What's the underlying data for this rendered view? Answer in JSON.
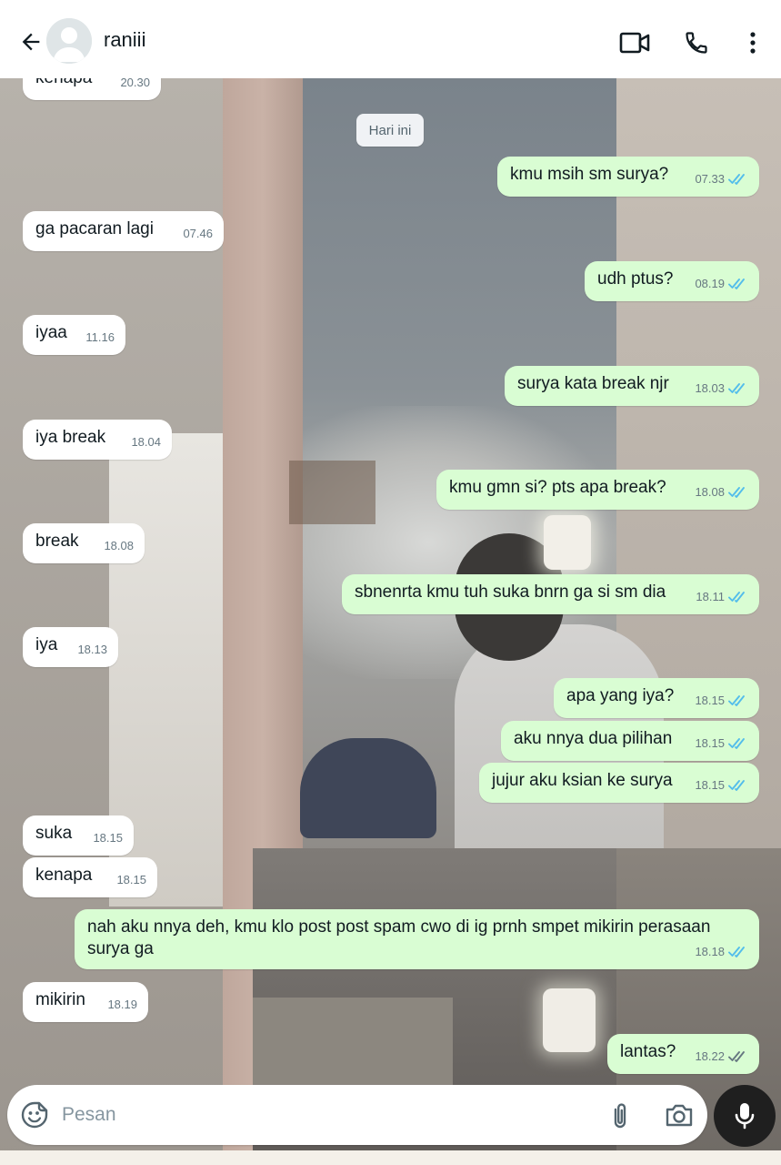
{
  "header": {
    "contact_name": "raniii"
  },
  "date_chip": "Hari ini",
  "messages": [
    {
      "dir": "in",
      "text": "kenapa",
      "time": "20.30"
    },
    {
      "dir": "out",
      "text": "kmu msih sm surya?",
      "time": "07.33",
      "status": "read"
    },
    {
      "dir": "in",
      "text": "ga pacaran lagi",
      "time": "07.46"
    },
    {
      "dir": "out",
      "text": "udh ptus?",
      "time": "08.19",
      "status": "read"
    },
    {
      "dir": "in",
      "text": "iyaa",
      "time": "11.16"
    },
    {
      "dir": "out",
      "text": "surya kata break njr",
      "time": "18.03",
      "status": "read"
    },
    {
      "dir": "in",
      "text": "iya break",
      "time": "18.04"
    },
    {
      "dir": "out",
      "text": "kmu gmn si? pts apa break?",
      "time": "18.08",
      "status": "read"
    },
    {
      "dir": "in",
      "text": "break",
      "time": "18.08"
    },
    {
      "dir": "out",
      "text": "sbnenrta kmu tuh suka bnrn ga si sm dia",
      "time": "18.11",
      "status": "read"
    },
    {
      "dir": "in",
      "text": "iya",
      "time": "18.13"
    },
    {
      "dir": "out",
      "text": "apa yang iya?",
      "time": "18.15",
      "status": "read"
    },
    {
      "dir": "out",
      "text": "aku nnya dua pilihan",
      "time": "18.15",
      "status": "read"
    },
    {
      "dir": "out",
      "text": "jujur aku ksian ke surya",
      "time": "18.15",
      "status": "read"
    },
    {
      "dir": "in",
      "text": "suka",
      "time": "18.15"
    },
    {
      "dir": "in",
      "text": "kenapa",
      "time": "18.15"
    },
    {
      "dir": "out",
      "text": "nah aku nnya deh, kmu klo post post spam cwo di ig prnh smpet mikirin perasaan surya ga",
      "time": "18.18",
      "status": "read"
    },
    {
      "dir": "in",
      "text": "mikirin",
      "time": "18.19"
    },
    {
      "dir": "out",
      "text": "lantas?",
      "time": "18.22",
      "status": "delivered"
    }
  ],
  "composer": {
    "placeholder": "Pesan"
  },
  "icons": {
    "back": "arrow-left-icon",
    "video": "video-call-icon",
    "call": "phone-icon",
    "menu": "more-vert-icon",
    "emoji": "sticker-icon",
    "attach": "paperclip-icon",
    "camera": "camera-icon",
    "mic": "microphone-icon"
  },
  "colors": {
    "incoming_bubble": "#ffffff",
    "outgoing_bubble": "#d9fdd3",
    "read_tick": "#53bdeb",
    "delivered_tick": "#667781"
  }
}
